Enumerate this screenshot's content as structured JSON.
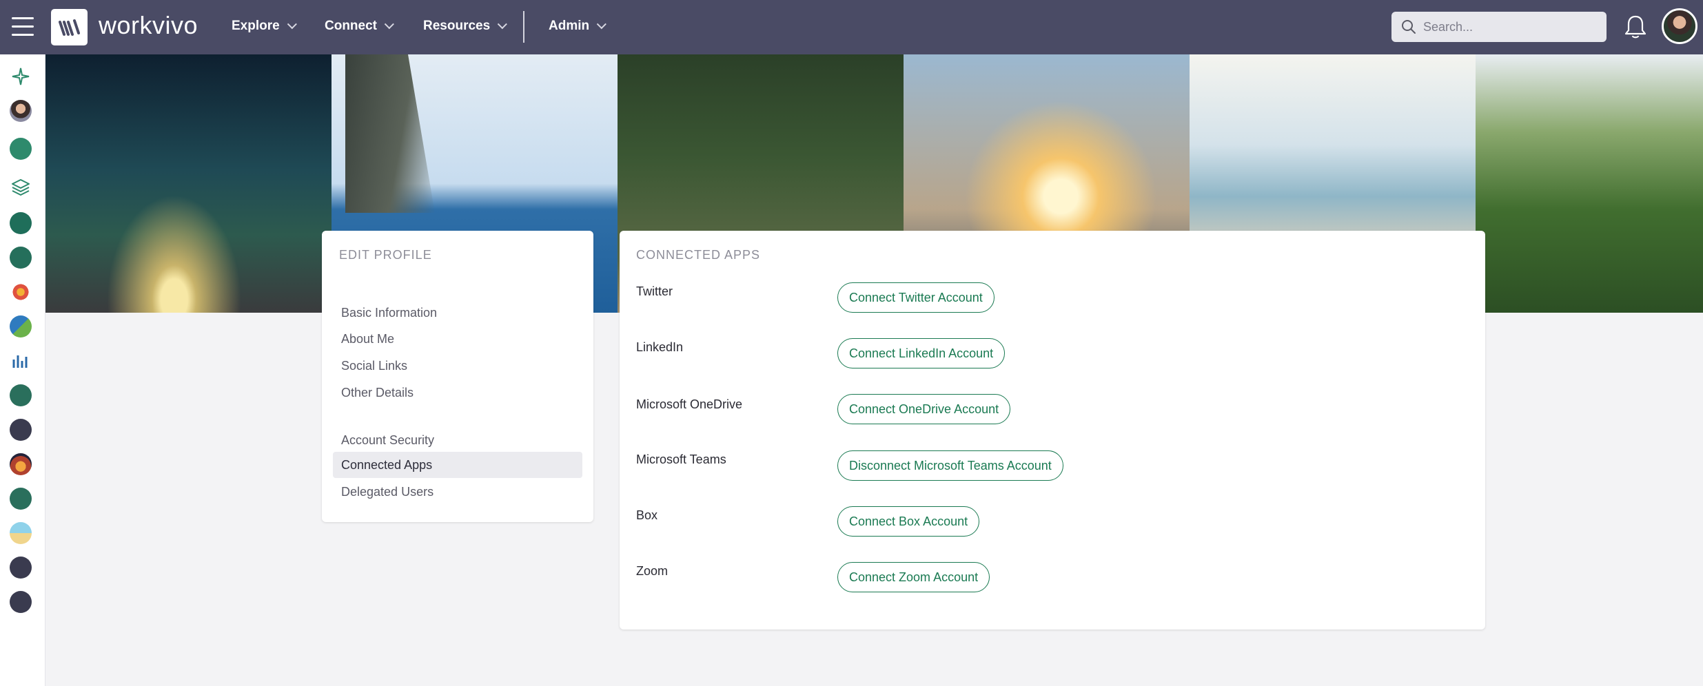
{
  "app": {
    "name": "workvivo",
    "accent_color": "#1a7a52",
    "topbar_color": "#4a4b65"
  },
  "nav": {
    "items": [
      {
        "label": "Explore"
      },
      {
        "label": "Connect"
      },
      {
        "label": "Resources"
      },
      {
        "label": "Admin"
      }
    ]
  },
  "search": {
    "placeholder": "Search..."
  },
  "rail": {
    "icons": [
      "sparkle-icon",
      "user-avatar-icon",
      "compass-icon",
      "layers-icon",
      "org-logo-icon",
      "org-logo-icon",
      "sun-logo-icon",
      "heart-globe-icon",
      "chart-icon",
      "org-logo-icon",
      "workvivo-logo-icon",
      "sunset-logo-icon",
      "org-logo-icon",
      "beach-logo-icon",
      "workvivo-logo-icon",
      "workvivo-logo-icon"
    ]
  },
  "edit_profile": {
    "heading": "EDIT PROFILE",
    "group1": [
      {
        "label": "Basic Information"
      },
      {
        "label": "About Me"
      },
      {
        "label": "Social Links"
      },
      {
        "label": "Other Details"
      }
    ],
    "group2": [
      {
        "label": "Account Security"
      },
      {
        "label": "Connected Apps",
        "active": true
      },
      {
        "label": "Delegated Users"
      }
    ]
  },
  "connected_apps": {
    "heading": "CONNECTED APPS",
    "apps": [
      {
        "name": "Twitter",
        "button": "Connect Twitter Account"
      },
      {
        "name": "LinkedIn",
        "button": "Connect LinkedIn Account"
      },
      {
        "name": "Microsoft OneDrive",
        "button": "Connect OneDrive Account"
      },
      {
        "name": "Microsoft Teams",
        "button": "Disconnect Microsoft Teams Account"
      },
      {
        "name": "Box",
        "button": "Connect Box Account"
      },
      {
        "name": "Zoom",
        "button": "Connect Zoom Account"
      }
    ]
  }
}
